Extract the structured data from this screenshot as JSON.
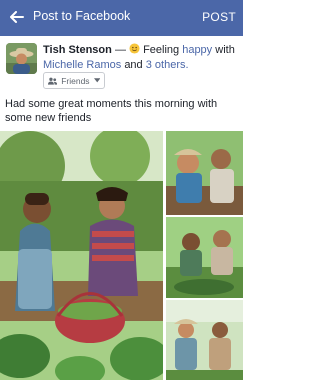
{
  "appbar": {
    "title": "Post to Facebook",
    "post_label": "POST"
  },
  "post": {
    "author": "Tish Stenson",
    "dash": "—",
    "feeling_prefix": "Feeling",
    "feeling": "happy",
    "with_label": "with",
    "tagged": "Michelle Ramos",
    "and_label": "and",
    "others": "3 others.",
    "privacy": "Friends",
    "status_text": "Had some great moments this morning with some new friends"
  },
  "colors": {
    "brand": "#4b67a8",
    "text": "#1d2129",
    "muted": "#606770"
  },
  "icons": [
    "back-arrow-icon",
    "smile-emoji-icon",
    "friends-icon",
    "caret-down-icon"
  ]
}
